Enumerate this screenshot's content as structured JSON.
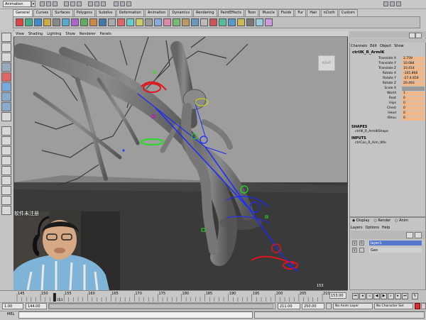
{
  "top_bar": {
    "mode": "Animation"
  },
  "shelf": {
    "tabs": [
      "General",
      "Curves",
      "Surfaces",
      "Polygons",
      "Subdivs",
      "Deformation",
      "Animation",
      "Dynamics",
      "Rendering",
      "PaintEffects",
      "Toon",
      "Muscle",
      "Fluids",
      "Fur",
      "Hair",
      "nCloth",
      "Custom"
    ],
    "active_tab": "General"
  },
  "viewport": {
    "menu": [
      "View",
      "Shading",
      "Lighting",
      "Show",
      "Renderer",
      "Panels"
    ],
    "viewcube_label": "RIGHT",
    "frame": "153"
  },
  "webcam": {
    "caption": "软件未注册"
  },
  "channel_box": {
    "menu": [
      "Channels",
      "Edit",
      "Object",
      "Show"
    ],
    "node_name": "ctrlIK_R_ArmIK",
    "attributes": [
      {
        "label": "Translate X",
        "value": "2.759",
        "highlight": true
      },
      {
        "label": "Translate Y",
        "value": "10.084",
        "highlight": true
      },
      {
        "label": "Translate Z",
        "value": "10.414",
        "highlight": true
      },
      {
        "label": "Rotate X",
        "value": "-105.868",
        "highlight": true
      },
      {
        "label": "Rotate Y",
        "value": "-27.4.659",
        "highlight": true
      },
      {
        "label": "Rotate Z",
        "value": "20.493",
        "highlight": true
      },
      {
        "label": "Scale X",
        "value": "",
        "highlight": false,
        "gray": true
      },
      {
        "label": "World",
        "value": "1",
        "highlight": true
      },
      {
        "label": "Root",
        "value": "0",
        "highlight": true
      },
      {
        "label": "Hips",
        "value": "0",
        "highlight": true
      },
      {
        "label": "Chest",
        "value": "0",
        "highlight": true
      },
      {
        "label": "Head",
        "value": "0",
        "highlight": true
      },
      {
        "label": "lShou",
        "value": "0",
        "highlight": true
      }
    ],
    "shapes_header": "SHAPES",
    "shapes_value": "ctrlIK_R_ArmIKShape",
    "inputs_header": "INPUTS",
    "inputs_value": "ctrlCon_R_Arm_IKfo"
  },
  "layer_editor": {
    "radios": [
      "Display",
      "Render",
      "Anim"
    ],
    "menu": [
      "Layers",
      "Options",
      "Help"
    ],
    "layers": [
      {
        "v": "V",
        "r": "R",
        "name": "layer1",
        "selected": true
      },
      {
        "v": "V",
        "r": "",
        "name": "Geo",
        "selected": false
      }
    ]
  },
  "timeline": {
    "ticks": [
      "145",
      "150",
      "155",
      "160",
      "165",
      "170",
      "175",
      "180",
      "185",
      "190",
      "195",
      "200",
      "205",
      "210"
    ],
    "current": "153",
    "current_field": "153.00"
  },
  "range": {
    "start": "1.00",
    "start_inner": "144.00",
    "end_inner": "211.00",
    "end": "250.00",
    "anim_layer": "No Anim Layer",
    "character_set": "No Character Set"
  },
  "command_line": {
    "label": "MEL"
  },
  "colors": {
    "highlight": "#f0b88a",
    "viewport_bg": "#9d9d9d",
    "rig_blue": "#1a2aff",
    "rig_red": "#e0141e"
  }
}
